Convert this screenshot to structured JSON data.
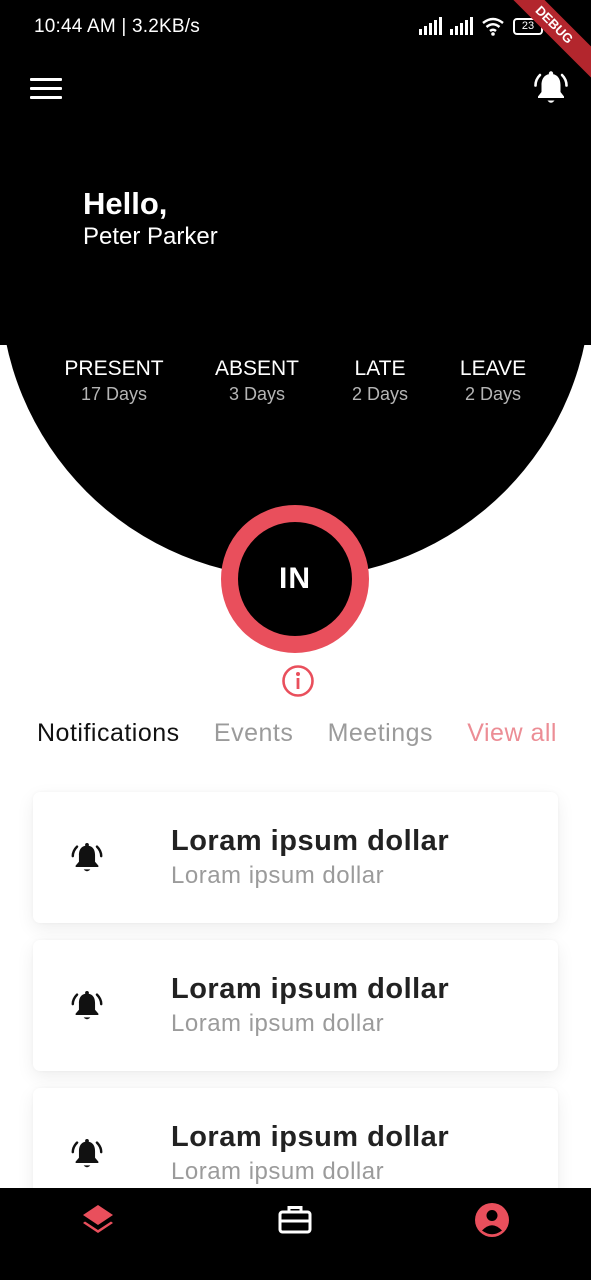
{
  "status_bar": {
    "time": "10:44 AM",
    "speed": "3.2KB/s",
    "battery": "23",
    "debug_banner": "DEBUG"
  },
  "header": {
    "menu_icon": "menu-icon",
    "bell_icon": "bell-ringing-icon",
    "greeting": "Hello,",
    "user_name": "Peter Parker"
  },
  "stats": [
    {
      "label": "PRESENT",
      "value": "17 Days"
    },
    {
      "label": "ABSENT",
      "value": "3 Days"
    },
    {
      "label": "LATE",
      "value": "2 Days"
    },
    {
      "label": "LEAVE",
      "value": "2 Days"
    }
  ],
  "check_in": {
    "label": "IN",
    "ring_color": "#e94f5c"
  },
  "info_icon": "info-icon",
  "tabs": {
    "notifications": "Notifications",
    "events": "Events",
    "meetings": "Meetings",
    "view_all": "View all"
  },
  "notifications": [
    {
      "title": "Loram ipsum dollar",
      "subtitle": "Loram ipsum dollar",
      "icon": "bell-ringing-icon"
    },
    {
      "title": "Loram ipsum dollar",
      "subtitle": "Loram ipsum dollar",
      "icon": "bell-ringing-icon"
    },
    {
      "title": "Loram ipsum dollar",
      "subtitle": "Loram ipsum dollar",
      "icon": "bell-ringing-icon"
    }
  ],
  "bottom_nav": {
    "items": [
      "layers-icon",
      "briefcase-icon",
      "account-icon"
    ],
    "active_color": "#e94f5c"
  },
  "colors": {
    "accent": "#e94f5c",
    "background": "#000000",
    "view_all": "#ec8d95"
  }
}
